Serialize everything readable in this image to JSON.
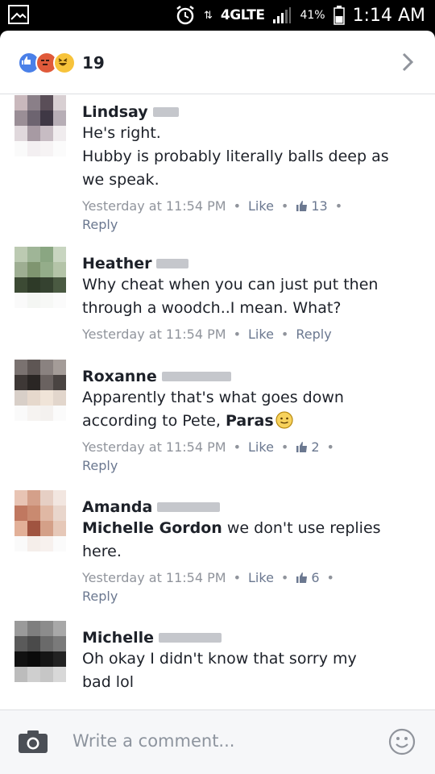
{
  "status_bar": {
    "network": "4GLTE",
    "battery": "41%",
    "time": "1:14 AM"
  },
  "reactions": {
    "types": [
      "like",
      "angry",
      "haha"
    ],
    "count": "19"
  },
  "comments": [
    {
      "name": "Lindsay",
      "text": [
        "He's right.",
        "Hubby is probably literally balls deep as",
        "we speak."
      ],
      "timestamp": "Yesterday at 11:54 PM",
      "like_label": "Like",
      "like_count": "13",
      "reply_label": "Reply"
    },
    {
      "name": "Heather",
      "text": [
        "Why cheat when you can just put then",
        "through a woodch..I mean. What?"
      ],
      "timestamp": "Yesterday at 11:54 PM",
      "like_label": "Like",
      "reply_label": "Reply"
    },
    {
      "name": "Roxanne",
      "text": [
        "Apparently that's what goes down",
        "according to Pete,"
      ],
      "tag": "Paras",
      "timestamp": "Yesterday at 11:54 PM",
      "like_label": "Like",
      "like_count": "2",
      "reply_label": "Reply"
    },
    {
      "name": "Amanda",
      "tag": "Michelle Gordon",
      "text": [
        "we don't use replies",
        "here."
      ],
      "timestamp": "Yesterday at 11:54 PM",
      "like_label": "Like",
      "like_count": "6",
      "reply_label": "Reply"
    },
    {
      "name": "Michelle",
      "text": [
        "Oh okay I didn't know that sorry my",
        "bad lol"
      ]
    }
  ],
  "composer": {
    "placeholder": "Write a comment..."
  },
  "colors": {
    "link": "#6b7890",
    "meta": "#90949c",
    "text": "#1d2129",
    "like_blue": "#4a80e8"
  }
}
